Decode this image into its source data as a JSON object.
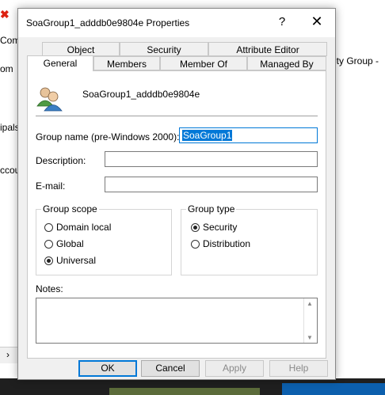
{
  "background": {
    "left_fragments": [
      "Com",
      "om",
      "ipals",
      "ccour"
    ],
    "right_fragment": "ity Group -",
    "scroll_arrow": "›"
  },
  "dialog": {
    "title": "SoaGroup1_adddb0e9804e Properties",
    "help_glyph": "?",
    "close_glyph": "✕",
    "tabs_back": [
      "Object",
      "Security",
      "Attribute Editor"
    ],
    "tabs_front": [
      "General",
      "Members",
      "Member Of",
      "Managed By"
    ],
    "active_tab": "General",
    "group_display_name": "SoaGroup1_adddb0e9804e",
    "fields": {
      "group_name_label": "Group name (pre-Windows 2000):",
      "group_name_value": "SoaGroup1",
      "description_label": "Description:",
      "description_value": "",
      "email_label": "E-mail:",
      "email_value": ""
    },
    "group_scope": {
      "title": "Group scope",
      "options": [
        "Domain local",
        "Global",
        "Universal"
      ],
      "selected": "Universal"
    },
    "group_type": {
      "title": "Group type",
      "options": [
        "Security",
        "Distribution"
      ],
      "selected": "Security"
    },
    "notes_label": "Notes:",
    "notes_value": "",
    "buttons": {
      "ok": "OK",
      "cancel": "Cancel",
      "apply": "Apply",
      "help": "Help"
    }
  },
  "colors": {
    "accent": "#0078d7",
    "taskbar_blue": "#0c5fad",
    "taskbar_green": "#5b6b3a"
  }
}
